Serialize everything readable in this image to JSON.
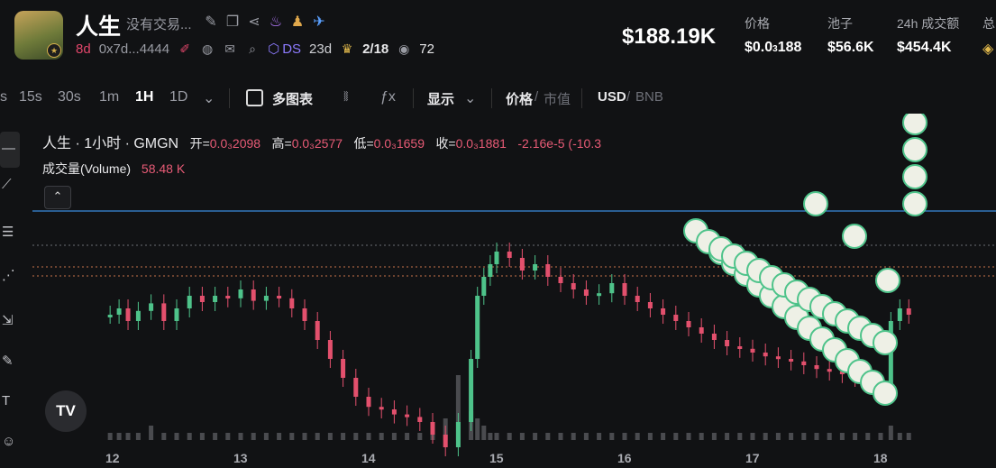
{
  "token": {
    "name": "人生",
    "description": "没有交易...",
    "age": "8d",
    "address": "0x7d...4444",
    "ds_label": "DS",
    "ds_age": "23d",
    "holders_ratio": "2/18",
    "views": "72"
  },
  "market": {
    "market_cap": "$188.19K",
    "price_label": "价格",
    "price_main": "$0.0",
    "price_sub": "3",
    "price_tail": "188",
    "pool_label": "池子",
    "pool_value": "$56.6K",
    "vol24_label": "24h 成交额",
    "vol24_value": "$454.4K",
    "extra_label": "总"
  },
  "toolbar": {
    "intervals": [
      "s",
      "15s",
      "30s",
      "1m",
      "1H",
      "1D"
    ],
    "active_interval": "1H",
    "multi_chart": "多图表",
    "display": "显示",
    "price": "价格",
    "mcap": "市值",
    "usd": "USD",
    "bnb": "BNB"
  },
  "legend": {
    "title": "人生 · 1小时 · GMGN",
    "open_label": "开=",
    "open_value": "0.0₃2098",
    "high_label": "高=",
    "high_value": "0.0₃2577",
    "low_label": "低=",
    "low_value": "0.0₃1659",
    "close_label": "收=",
    "close_value": "0.0₃1881",
    "change": "-2.16e-5 (-10.3",
    "volume_label": "成交量(Volume)",
    "volume_value": "58.48 K"
  },
  "colors": {
    "up": "#4ec38a",
    "down": "#e3506d",
    "volume": "#4a4b4f",
    "hline": "#3a8dde"
  },
  "chart_data": {
    "type": "candlestick",
    "x_tick_labels": [
      "12",
      "13",
      "14",
      "15",
      "16",
      "17",
      "18"
    ],
    "ohlc_points": [
      [
        11.98,
        2.05
      ],
      [
        12.05,
        2.1
      ],
      [
        12.12,
        2.0
      ],
      [
        12.2,
        2.08
      ],
      [
        12.3,
        2.14
      ],
      [
        12.4,
        2.0
      ],
      [
        12.5,
        2.1
      ],
      [
        12.6,
        2.2
      ],
      [
        12.7,
        2.15
      ],
      [
        12.8,
        2.2
      ],
      [
        12.9,
        2.18
      ],
      [
        13.0,
        2.25
      ],
      [
        13.1,
        2.16
      ],
      [
        13.2,
        2.2
      ],
      [
        13.3,
        2.18
      ],
      [
        13.4,
        2.1
      ],
      [
        13.5,
        2.0
      ],
      [
        13.6,
        1.85
      ],
      [
        13.7,
        1.7
      ],
      [
        13.8,
        1.55
      ],
      [
        13.9,
        1.4
      ],
      [
        14.0,
        1.32
      ],
      [
        14.1,
        1.3
      ],
      [
        14.2,
        1.26
      ],
      [
        14.3,
        1.24
      ],
      [
        14.4,
        1.2
      ],
      [
        14.5,
        1.1
      ],
      [
        14.6,
        1.0
      ],
      [
        14.7,
        1.2
      ],
      [
        14.8,
        1.7
      ],
      [
        14.85,
        2.2
      ],
      [
        14.9,
        2.35
      ],
      [
        14.95,
        2.45
      ],
      [
        15.0,
        2.55
      ],
      [
        15.1,
        2.5
      ],
      [
        15.2,
        2.4
      ],
      [
        15.3,
        2.45
      ],
      [
        15.4,
        2.35
      ],
      [
        15.5,
        2.3
      ],
      [
        15.6,
        2.25
      ],
      [
        15.7,
        2.2
      ],
      [
        15.8,
        2.22
      ],
      [
        15.9,
        2.3
      ],
      [
        16.0,
        2.2
      ],
      [
        16.1,
        2.15
      ],
      [
        16.2,
        2.1
      ],
      [
        16.3,
        2.05
      ],
      [
        16.4,
        2.0
      ],
      [
        16.5,
        1.95
      ],
      [
        16.6,
        1.9
      ],
      [
        16.7,
        1.85
      ],
      [
        16.8,
        1.8
      ],
      [
        16.9,
        1.78
      ],
      [
        17.0,
        1.75
      ],
      [
        17.1,
        1.72
      ],
      [
        17.2,
        1.7
      ],
      [
        17.3,
        1.68
      ],
      [
        17.4,
        1.65
      ],
      [
        17.5,
        1.62
      ],
      [
        17.6,
        1.6
      ],
      [
        17.7,
        1.58
      ],
      [
        17.8,
        1.55
      ],
      [
        17.9,
        1.52
      ],
      [
        18.0,
        1.5
      ],
      [
        18.08,
        2.0
      ],
      [
        18.15,
        2.1
      ],
      [
        18.22,
        2.05
      ]
    ],
    "volume": [
      1,
      1,
      1,
      1,
      2,
      1,
      1,
      1,
      1,
      1,
      1,
      1,
      1,
      1,
      1,
      1,
      1,
      1,
      1,
      1,
      1,
      1,
      1,
      1,
      1,
      1,
      1,
      3,
      9,
      4,
      3,
      2,
      1,
      1,
      1,
      1,
      1,
      1,
      1,
      1,
      1,
      1,
      1,
      1,
      1,
      1,
      1,
      1,
      1,
      1,
      1,
      1,
      1,
      1,
      1,
      1,
      1,
      1,
      1,
      1,
      1,
      1,
      1,
      1,
      2,
      1,
      1
    ]
  }
}
